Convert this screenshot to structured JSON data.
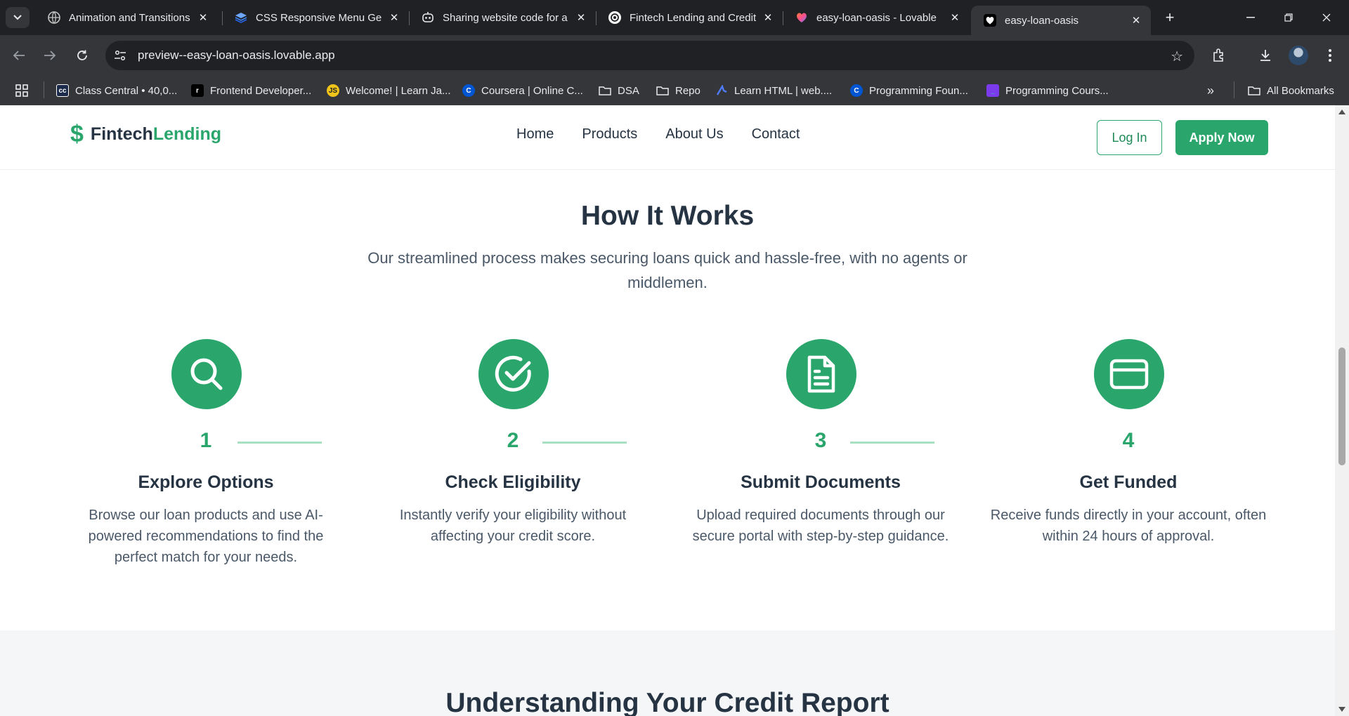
{
  "browser": {
    "tabs": [
      {
        "title": "Animation and Transitions",
        "icon": "globe-icon"
      },
      {
        "title": "CSS Responsive Menu Gen",
        "icon": "layers-icon"
      },
      {
        "title": "Sharing website code for a",
        "icon": "chatbot-icon"
      },
      {
        "title": "Fintech Lending and Credit",
        "icon": "openai-icon"
      },
      {
        "title": "easy-loan-oasis - Lovable",
        "icon": "heart-gradient-icon"
      },
      {
        "title": "easy-loan-oasis",
        "icon": "heart-icon",
        "active": true
      }
    ],
    "url": "preview--easy-loan-oasis.lovable.app",
    "bookmarks": [
      {
        "label": "Class Central • 40,0...",
        "icon": "cc"
      },
      {
        "label": "Frontend Developer...",
        "icon": "r"
      },
      {
        "label": "Welcome! | Learn Ja...",
        "icon": "JS"
      },
      {
        "label": "Coursera | Online C...",
        "icon": "C"
      },
      {
        "label": "DSA",
        "icon": "folder-icon"
      },
      {
        "label": "Repo",
        "icon": "folder-icon"
      },
      {
        "label": "Learn HTML | web....",
        "icon": "runner"
      },
      {
        "label": "Programming Foun...",
        "icon": "C"
      },
      {
        "label": "Programming Cours...",
        "icon": "bracket"
      }
    ],
    "all_bookmarks": "All Bookmarks",
    "accent": "#2aa66c"
  },
  "site": {
    "brand_part1": "Fintech",
    "brand_part2": "Lending",
    "nav": [
      "Home",
      "Products",
      "About Us",
      "Contact"
    ],
    "login": "Log In",
    "apply": "Apply Now"
  },
  "how": {
    "title": "How It Works",
    "subtitle": "Our streamlined process makes securing loans quick and hassle-free, with no agents or middlemen.",
    "steps": [
      {
        "num": "1",
        "title": "Explore Options",
        "desc": "Browse our loan products and use AI-powered recommendations to find the perfect match for your needs.",
        "icon": "search-icon"
      },
      {
        "num": "2",
        "title": "Check Eligibility",
        "desc": "Instantly verify your eligibility without affecting your credit score.",
        "icon": "check-circle-icon"
      },
      {
        "num": "3",
        "title": "Submit Documents",
        "desc": "Upload required documents through our secure portal with step-by-step guidance.",
        "icon": "document-icon"
      },
      {
        "num": "4",
        "title": "Get Funded",
        "desc": "Receive funds directly in your account, often within 24 hours of approval.",
        "icon": "credit-card-icon"
      }
    ]
  },
  "credit": {
    "title": "Understanding Your Credit Report"
  }
}
